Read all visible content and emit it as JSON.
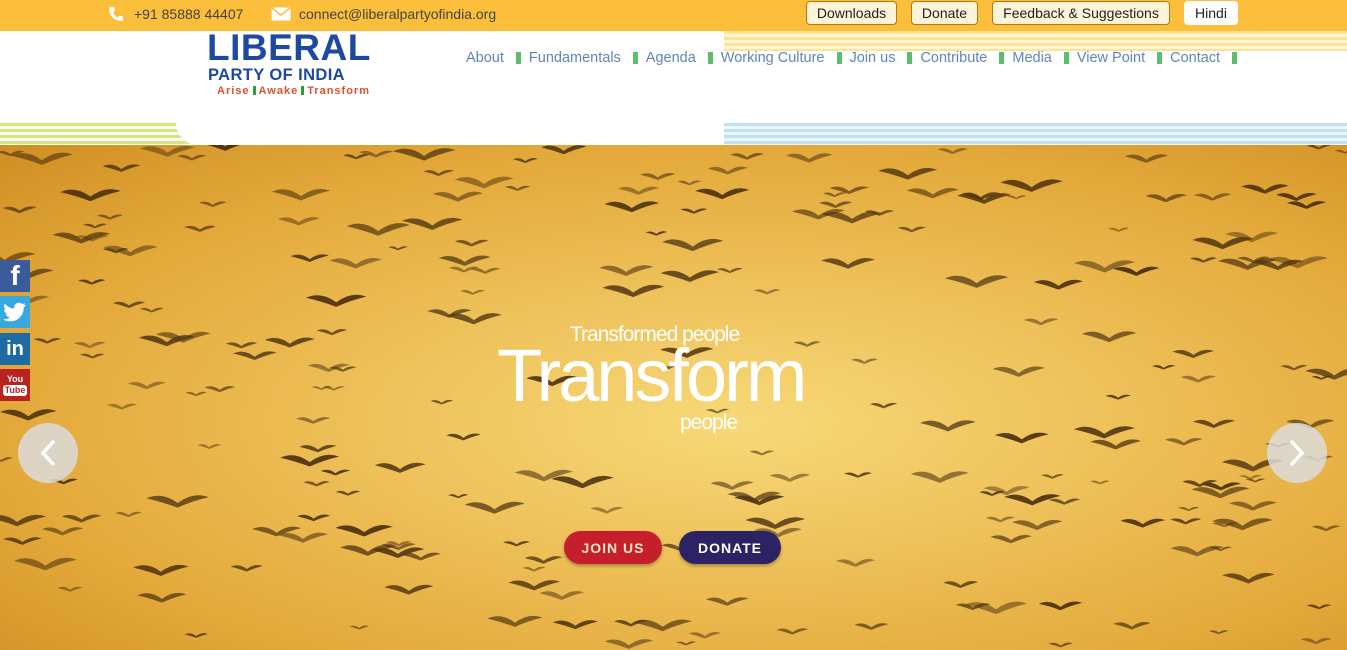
{
  "topbar": {
    "phone": "+91 85888 44407",
    "email": "connect@liberalpartyofindia.org",
    "phone_icon": "phone-icon",
    "email_icon": "envelope-icon",
    "buttons": {
      "downloads": "Downloads",
      "donate": "Donate",
      "feedback": "Feedback & Suggestions",
      "hindi": "Hindi"
    }
  },
  "logo": {
    "line1": "LIBERAL",
    "line2": "PARTY OF INDIA",
    "tagline": [
      "Arise",
      "Awake",
      "Transform"
    ]
  },
  "nav": {
    "items": [
      "About",
      "Fundamentals",
      "Agenda",
      "Working Culture",
      "Join us",
      "Contribute",
      "Media",
      "View Point",
      "Contact"
    ]
  },
  "hero": {
    "small_line": "Transformed people",
    "big_line": "Transform",
    "people_line": "people",
    "join_label": "JOIN US",
    "donate_label": "DONATE",
    "prev_icon": "chevron-left-icon",
    "next_icon": "chevron-right-icon"
  },
  "social": [
    "facebook-icon",
    "twitter-icon",
    "linkedin-icon",
    "youtube-icon"
  ],
  "colors": {
    "topbar": "#fbbf3c",
    "brand_blue": "#1d4aa0",
    "nav_text": "#5f86b8",
    "nav_separator": "#5cbd6a",
    "join_button": "#c51f2e",
    "donate_button": "#2b2363"
  }
}
